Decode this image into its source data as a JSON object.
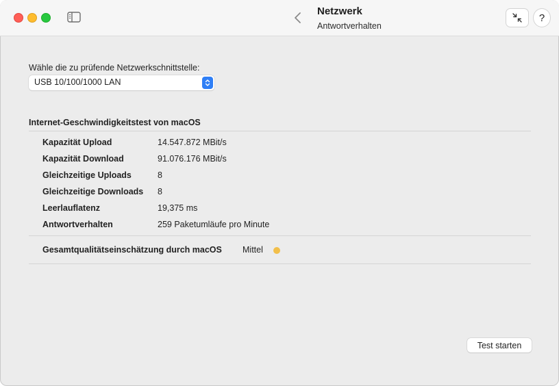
{
  "window": {
    "title": "Netzwerk",
    "subtitle": "Antwortverhalten",
    "help_label": "?"
  },
  "interface": {
    "prompt": "Wähle die zu prüfende Netzwerkschnittstelle:",
    "selected": "USB 10/100/1000 LAN"
  },
  "speedtest": {
    "heading": "Internet-Geschwindigkeitstest von macOS",
    "rows": [
      {
        "label": "Kapazität Upload",
        "value": "14.547.872 MBit/s"
      },
      {
        "label": "Kapazität Download",
        "value": "91.076.176 MBit/s"
      },
      {
        "label": "Gleichzeitige Uploads",
        "value": "8"
      },
      {
        "label": "Gleichzeitige Downloads",
        "value": "8"
      },
      {
        "label": "Leerlauflatenz",
        "value": "19,375 ms"
      },
      {
        "label": "Antwortverhalten",
        "value": "259 Paketumläufe pro Minute"
      }
    ],
    "quality_label": "Gesamtqualitätseinschätzung durch macOS",
    "quality_value": "Mittel",
    "quality_color": "#f2bf4a"
  },
  "actions": {
    "start_label": "Test starten"
  },
  "colors": {
    "accent": "#2f7ff6",
    "close": "#ff5f57",
    "minimize": "#febc2e",
    "zoom": "#28c840"
  }
}
